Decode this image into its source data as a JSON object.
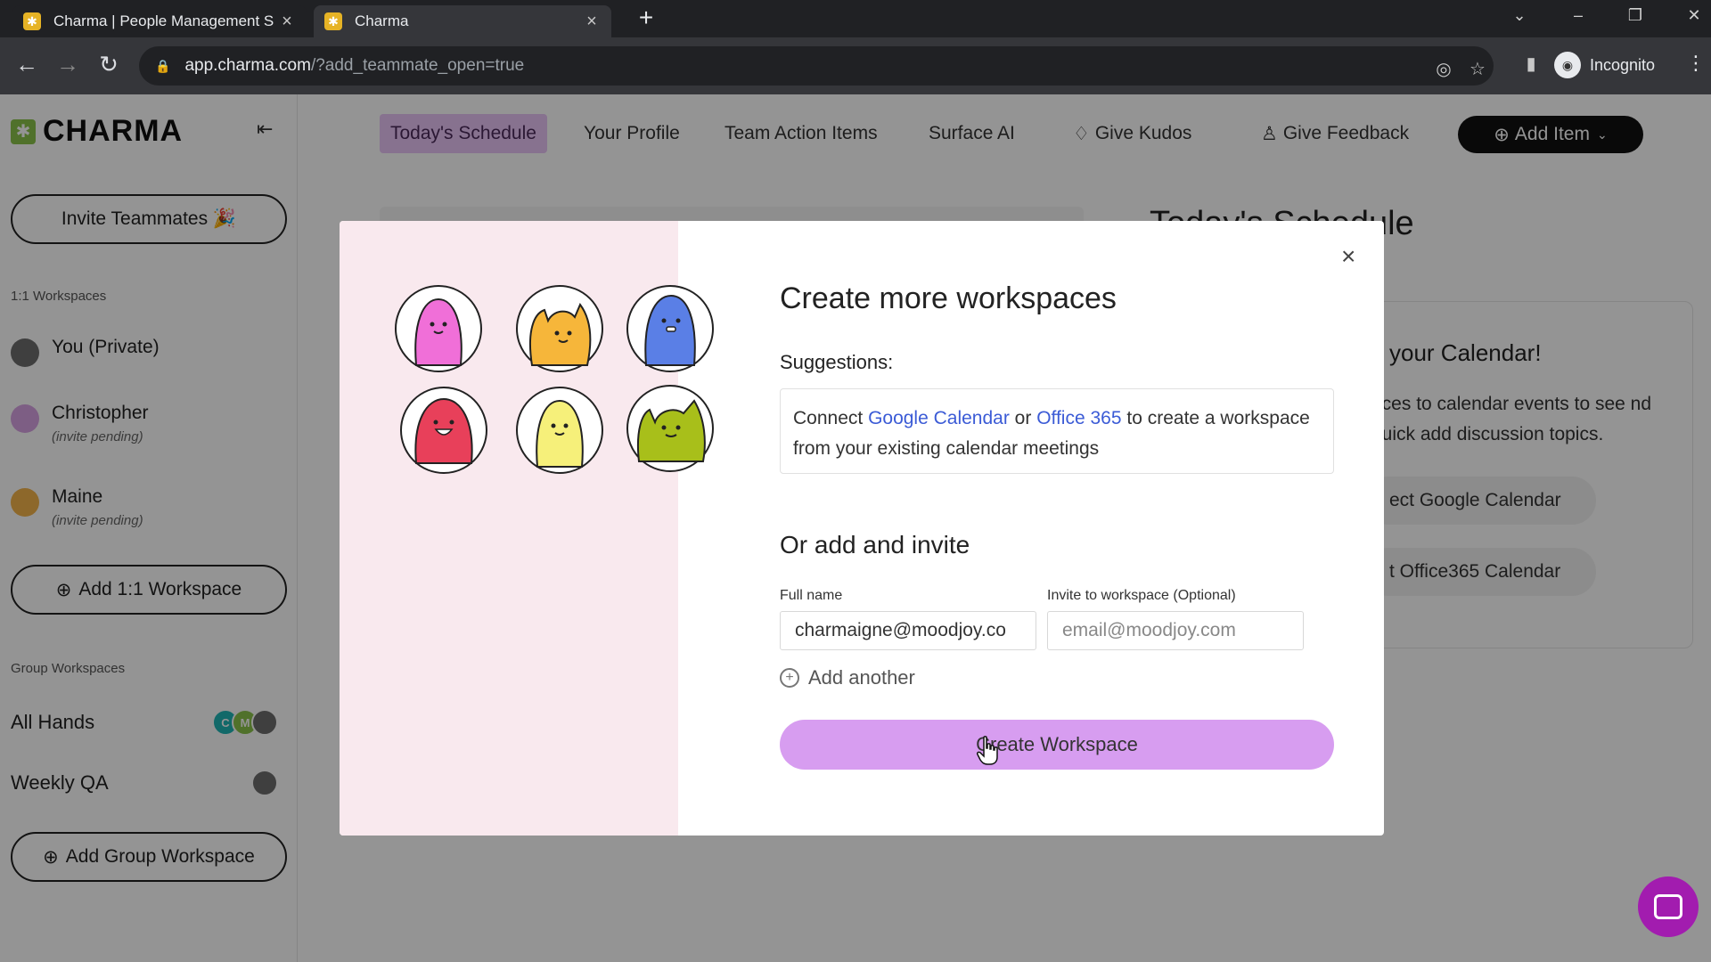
{
  "browser": {
    "tabs": [
      {
        "title": "Charma | People Management S",
        "active": false
      },
      {
        "title": "Charma",
        "active": true
      }
    ],
    "url_domain": "app.charma.com",
    "url_path": "/?add_teammate_open=true",
    "profile_label": "Incognito"
  },
  "app": {
    "brand": "CHARMA",
    "invite_button": "Invite Teammates 🎉",
    "one_on_one_label": "1:1 Workspaces",
    "one_on_one_items": [
      {
        "name": "You (Private)",
        "sub": ""
      },
      {
        "name": "Christopher",
        "sub": "(invite pending)"
      },
      {
        "name": "Maine",
        "sub": "(invite pending)"
      }
    ],
    "add_one_on_one": "Add 1:1 Workspace",
    "group_label": "Group Workspaces",
    "group_items": [
      {
        "name": "All Hands"
      },
      {
        "name": "Weekly QA"
      }
    ],
    "add_group": "Add Group Workspace",
    "nav": {
      "todays_schedule": "Today's Schedule",
      "your_profile": "Your Profile",
      "team_action_items": "Team Action Items",
      "surface_ai": "Surface AI",
      "give_kudos": "Give Kudos",
      "give_feedback": "Give Feedback",
      "add_item": "Add Item"
    },
    "background": {
      "heading": "Today's Schedule",
      "card_title": "your Calendar!",
      "card_text": "aces to calendar events to see nd quick add discussion topics.",
      "btn_google": "ect Google Calendar",
      "btn_office": "t Office365 Calendar"
    }
  },
  "modal": {
    "title": "Create more workspaces",
    "suggestions_label": "Suggestions:",
    "suggest_prefix": "Connect ",
    "suggest_google": "Google Calendar",
    "suggest_or": " or ",
    "suggest_office": "Office 365",
    "suggest_suffix": " to create a workspace from your existing calendar meetings",
    "or_title": "Or add and invite",
    "full_name_label": "Full name",
    "full_name_value": "charmaigne@moodjoy.co",
    "invite_label": "Invite to workspace (Optional)",
    "invite_placeholder": "email@moodjoy.com",
    "add_another": "Add another",
    "create_button": "Create Workspace"
  },
  "colors": {
    "accent_purple": "#d79df0",
    "active_nav": "#e9c4f7",
    "link_blue": "#3b5bd6",
    "modal_left_bg": "#f9e9ee",
    "chat_bubble": "#a21caf"
  },
  "icons": [
    "close-icon",
    "plus-icon",
    "lock-icon",
    "star-icon",
    "chat-icon",
    "collapse-icon",
    "kudos-icon",
    "feedback-icon"
  ]
}
